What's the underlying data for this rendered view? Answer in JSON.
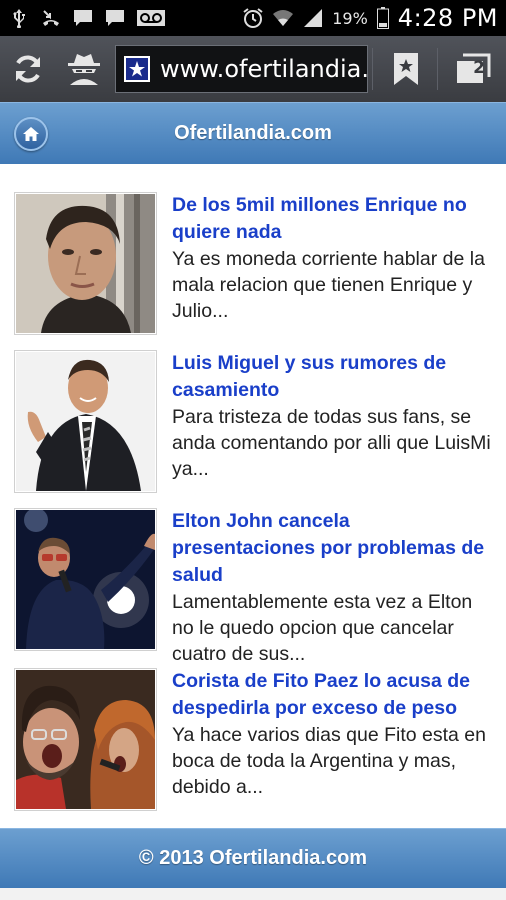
{
  "status_bar": {
    "icons": [
      "usb-icon",
      "missed-call-icon",
      "message-icon",
      "message-icon",
      "voicemail-icon",
      "alarm-icon",
      "wifi-icon",
      "signal-icon",
      "battery-icon"
    ],
    "battery": "19%",
    "time": "4:28 PM"
  },
  "toolbar": {
    "url": "www.ofertilandia.c",
    "tabs_count": "2"
  },
  "header": {
    "title": "Ofertilandia.com"
  },
  "articles": [
    {
      "title": "De los 5mil millones Enrique no quiere nada",
      "excerpt": "Ya es moneda corriente hablar de la mala relacion que tienen Enrique y Julio..."
    },
    {
      "title": "Luis Miguel y sus rumores de casamiento",
      "excerpt": "Para tristeza de todas sus fans, se anda comentando por alli que LuisMi ya..."
    },
    {
      "title": "Elton John cancela presentaciones por problemas de salud",
      "excerpt": "Lamentablemente esta vez a Elton no le quedo opcion que cancelar cuatro de sus..."
    },
    {
      "title": "Corista de Fito Paez lo acusa de despedirla por exceso de peso",
      "excerpt": "Ya hace varios dias que Fito esta en boca de toda la Argentina y mas, debido a..."
    }
  ],
  "footer": {
    "text": "© 2013 Ofertilandia.com"
  },
  "colors": {
    "header_blue": "#3f79b6",
    "link_blue": "#1a3fc9",
    "toolbar_gray": "#3a3c41"
  }
}
